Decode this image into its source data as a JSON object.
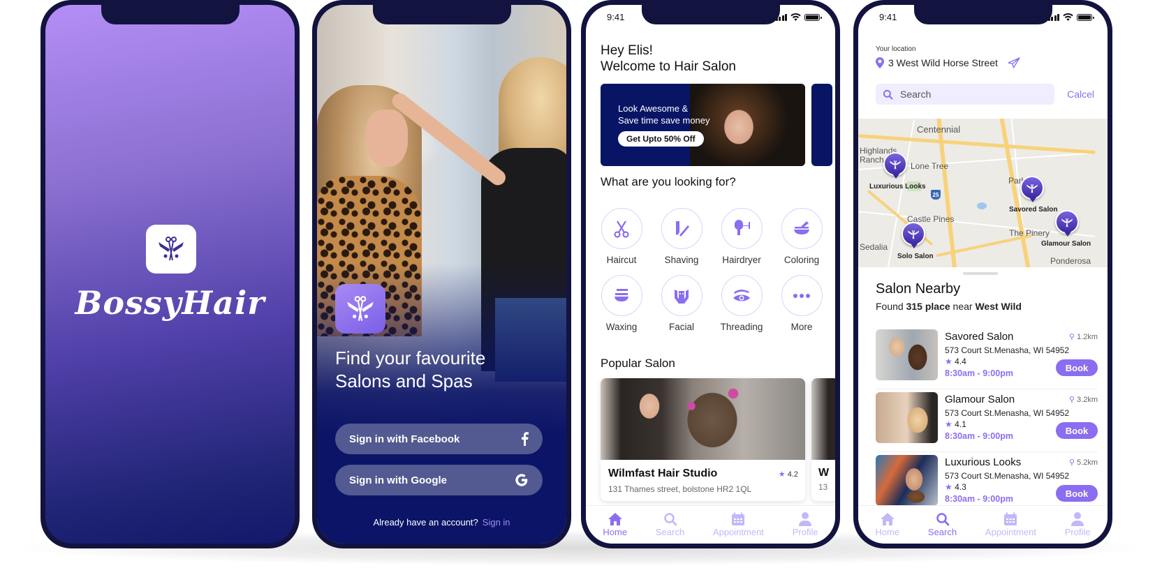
{
  "colors": {
    "accent": "#8b6df0",
    "frame": "#12133f",
    "navy": "#0b1466",
    "light_accent": "#c4b7f7"
  },
  "status_bar": {
    "time": "9:41"
  },
  "splash": {
    "brand_name": "BossyHair",
    "logo_icon": "scissors-comb-butterfly-icon"
  },
  "onboarding": {
    "headline_line1": "Find your favourite",
    "headline_line2": "Salons and Spas",
    "facebook_button": "Sign in with Facebook",
    "google_button": "Sign in with Google",
    "facebook_icon": "facebook-icon",
    "google_icon": "google-icon",
    "already_text": "Already have an account?",
    "sign_in_link": "Sign in"
  },
  "home": {
    "greeting_line1": "Hey Elis!",
    "greeting_line2": "Welcome to Hair Salon",
    "banner": {
      "line1": "Look Awesome &",
      "line2": "Save time save money",
      "button": "Get Upto 50% Off"
    },
    "looking_for_title": "What are you looking for?",
    "categories": [
      {
        "label": "Haircut",
        "icon": "scissors-icon"
      },
      {
        "label": "Shaving",
        "icon": "razor-icon"
      },
      {
        "label": "Hairdryer",
        "icon": "hairdryer-icon"
      },
      {
        "label": "Coloring",
        "icon": "coloring-bowl-icon"
      },
      {
        "label": "Waxing",
        "icon": "wax-bowl-icon"
      },
      {
        "label": "Facial",
        "icon": "facial-icon"
      },
      {
        "label": "Threading",
        "icon": "eye-icon"
      },
      {
        "label": "More",
        "icon": "more-dots-icon"
      }
    ],
    "popular_title": "Popular Salon",
    "popular_salons": [
      {
        "name": "Wilmfast Hair Studio",
        "rating": "4.2",
        "address": "131 Thames street, bolstone HR2 1QL"
      },
      {
        "name": "W",
        "address": "13"
      }
    ]
  },
  "tabbar": {
    "tabs": [
      {
        "label": "Home",
        "icon": "home-icon"
      },
      {
        "label": "Search",
        "icon": "search-icon"
      },
      {
        "label": "Appointment",
        "icon": "calendar-icon"
      },
      {
        "label": "Profile",
        "icon": "user-icon"
      }
    ],
    "home_screen_active": "Home",
    "search_screen_active": "Search"
  },
  "search": {
    "location_label": "Your location",
    "location_value": "3 West Wild Horse Street",
    "search_placeholder": "Search",
    "cancel_label": "Calcel",
    "map": {
      "places": [
        "Centennial",
        "Highlands Ranch",
        "Lone Tree",
        "Parker",
        "Castle Pines",
        "The Pinery",
        "Sedalia",
        "Ponderosa"
      ],
      "highway": "25",
      "pins": [
        "Luxurious Looks",
        "Savored Salon",
        "Solo Salon",
        "Glamour Salon"
      ]
    },
    "nearby_title": "Salon Nearby",
    "found_prefix": "Found",
    "found_count": "315 place",
    "found_mid": "near",
    "found_place": "West Wild",
    "salons": [
      {
        "name": "Savored Salon",
        "distance": "1.2km",
        "address": "573 Court St.Menasha, WI 54952",
        "rating": "4.4",
        "hours": "8:30am - 9:00pm",
        "book": "Book"
      },
      {
        "name": "Glamour Salon",
        "distance": "3.2km",
        "address": "573 Court St.Menasha, WI 54952",
        "rating": "4.1",
        "hours": "8:30am - 9:00pm",
        "book": "Book"
      },
      {
        "name": "Luxurious Looks",
        "distance": "5.2km",
        "address": "573 Court St.Menasha, WI 54952",
        "rating": "4.3",
        "hours": "8:30am - 9:00pm",
        "book": "Book"
      }
    ]
  }
}
